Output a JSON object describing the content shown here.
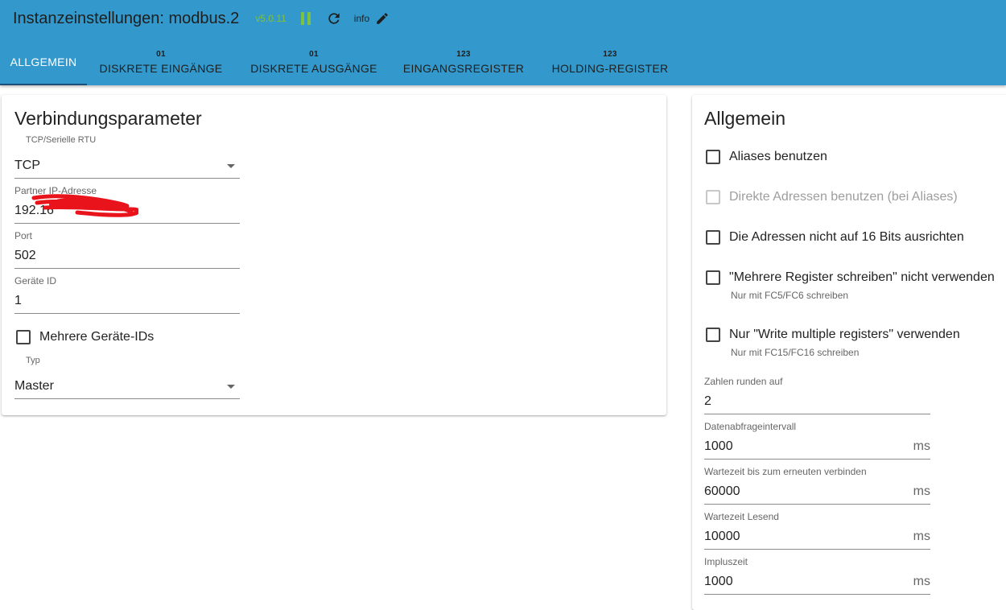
{
  "header": {
    "title": "Instanzeinstellungen: modbus.2",
    "version": "v5.0.11",
    "info_label": "info"
  },
  "tabs": [
    {
      "label": "ALLGEMEIN",
      "badge": ""
    },
    {
      "label": "DISKRETE EINGÄNGE",
      "badge": "01"
    },
    {
      "label": "DISKRETE AUSGÄNGE",
      "badge": "01"
    },
    {
      "label": "EINGANGSREGISTER",
      "badge": "123"
    },
    {
      "label": "HOLDING-REGISTER",
      "badge": "123"
    }
  ],
  "connection": {
    "title": "Verbindungsparameter",
    "mode_label": "TCP/Serielle RTU",
    "mode_value": "TCP",
    "ip_label": "Partner IP-Adresse",
    "ip_value": "192.16",
    "port_label": "Port",
    "port_value": "502",
    "device_id_label": "Geräte ID",
    "device_id_value": "1",
    "multi_ids_label": "Mehrere Geräte-IDs",
    "type_label": "Typ",
    "type_value": "Master"
  },
  "general": {
    "title": "Allgemein",
    "checkboxes": [
      {
        "label": "Aliases benutzen",
        "hint": "",
        "checked": false,
        "disabled": false
      },
      {
        "label": "Direkte Adressen benutzen (bei Aliases)",
        "hint": "",
        "checked": false,
        "disabled": true
      },
      {
        "label": "Die Adressen nicht auf 16 Bits ausrichten",
        "hint": "",
        "checked": false,
        "disabled": false
      },
      {
        "label": "\"Mehrere Register schreiben\" nicht verwenden",
        "hint": "Nur mit FC5/FC6 schreiben",
        "checked": false,
        "disabled": false
      },
      {
        "label": "Nur \"Write multiple registers\" verwenden",
        "hint": "Nur mit FC15/FC16 schreiben",
        "checked": false,
        "disabled": false
      }
    ],
    "fields": [
      {
        "label": "Zahlen runden auf",
        "value": "2",
        "unit": ""
      },
      {
        "label": "Datenabfrageintervall",
        "value": "1000",
        "unit": "ms"
      },
      {
        "label": "Wartezeit bis zum erneuten verbinden",
        "value": "60000",
        "unit": "ms"
      },
      {
        "label": "Wartezeit Lesend",
        "value": "10000",
        "unit": "ms"
      },
      {
        "label": "Impluszeit",
        "value": "1000",
        "unit": "ms"
      }
    ]
  },
  "colors": {
    "appbar": "#3399cc",
    "accent_green": "#7dc143"
  }
}
